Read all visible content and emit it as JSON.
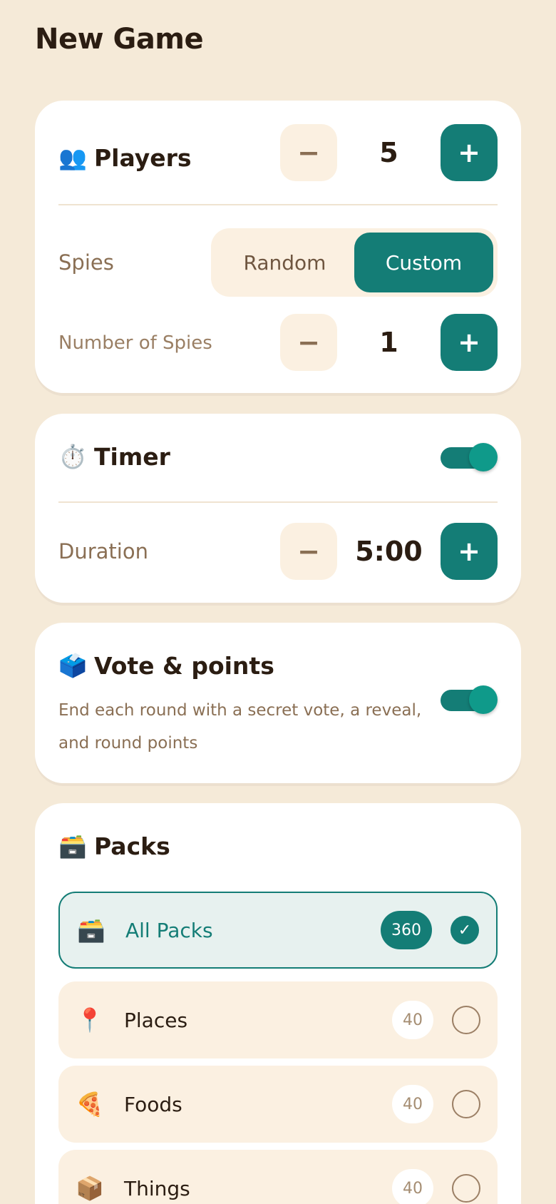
{
  "page": {
    "title": "New Game"
  },
  "players": {
    "emoji": "👥",
    "label": "Players",
    "minus": "−",
    "value": "5",
    "plus": "+"
  },
  "spies": {
    "label": "Spies",
    "options": [
      "Random",
      "Custom"
    ],
    "selected": "Custom",
    "count_label": "Number of Spies",
    "count_value": "1"
  },
  "timer": {
    "emoji": "⏱️",
    "label": "Timer",
    "enabled": true,
    "duration_label": "Duration",
    "duration_value": "5:00"
  },
  "vote": {
    "emoji": "🗳️",
    "label": "Vote & points",
    "description": "End each round with a secret vote, a reveal, and round points",
    "enabled": true
  },
  "packs": {
    "emoji": "🗃️",
    "label": "Packs",
    "items": [
      {
        "emoji": "🗃️",
        "name": "All Packs",
        "count": "360",
        "selected": true,
        "check": "✓"
      },
      {
        "emoji": "📍",
        "name": "Places",
        "count": "40",
        "selected": false,
        "check": ""
      },
      {
        "emoji": "🍕",
        "name": "Foods",
        "count": "40",
        "selected": false,
        "check": ""
      },
      {
        "emoji": "📦",
        "name": "Things",
        "count": "40",
        "selected": false,
        "check": ""
      }
    ]
  },
  "colors": {
    "accent": "#147d76",
    "background": "#f5ead8",
    "card": "#ffffff"
  }
}
